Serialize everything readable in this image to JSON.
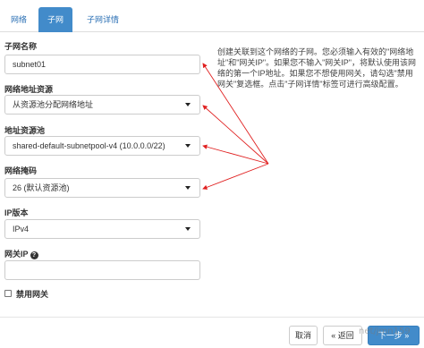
{
  "tabs": [
    {
      "label": "网络"
    },
    {
      "label": "子网",
      "active": true
    },
    {
      "label": "子网详情"
    }
  ],
  "form": {
    "subnet_name": {
      "label": "子网名称",
      "value": "subnet01"
    },
    "address_source": {
      "label": "网络地址资源",
      "value": "从资源池分配网络地址"
    },
    "address_pool": {
      "label": "地址资源池",
      "value": "shared-default-subnetpool-v4 (10.0.0.0/22)"
    },
    "network_mask": {
      "label": "网络掩码",
      "value": "26 (默认资源池)"
    },
    "ip_version": {
      "label": "IP版本",
      "value": "IPv4"
    },
    "gateway_ip": {
      "label": "网关IP",
      "value": "",
      "help_icon": "?"
    },
    "disable_gateway": {
      "label": "禁用网关",
      "checked": false
    }
  },
  "help_text": "创建关联到这个网络的子网。您必须输入有效的\"网络地址\"和\"网关IP\"。如果您不输入\"网关IP\"，将默认使用该网络的第一个IP地址。如果您不想使用网关，请勾选\"禁用网关\"复选框。点击\"子网详情\"标签可进行高级配置。",
  "footer": {
    "cancel": "取消",
    "back": "« 返回",
    "next": "下一步 »"
  },
  "watermark": "net/jmn159",
  "colors": {
    "accent": "#428bca",
    "annotation_arrow": "#e02020"
  }
}
